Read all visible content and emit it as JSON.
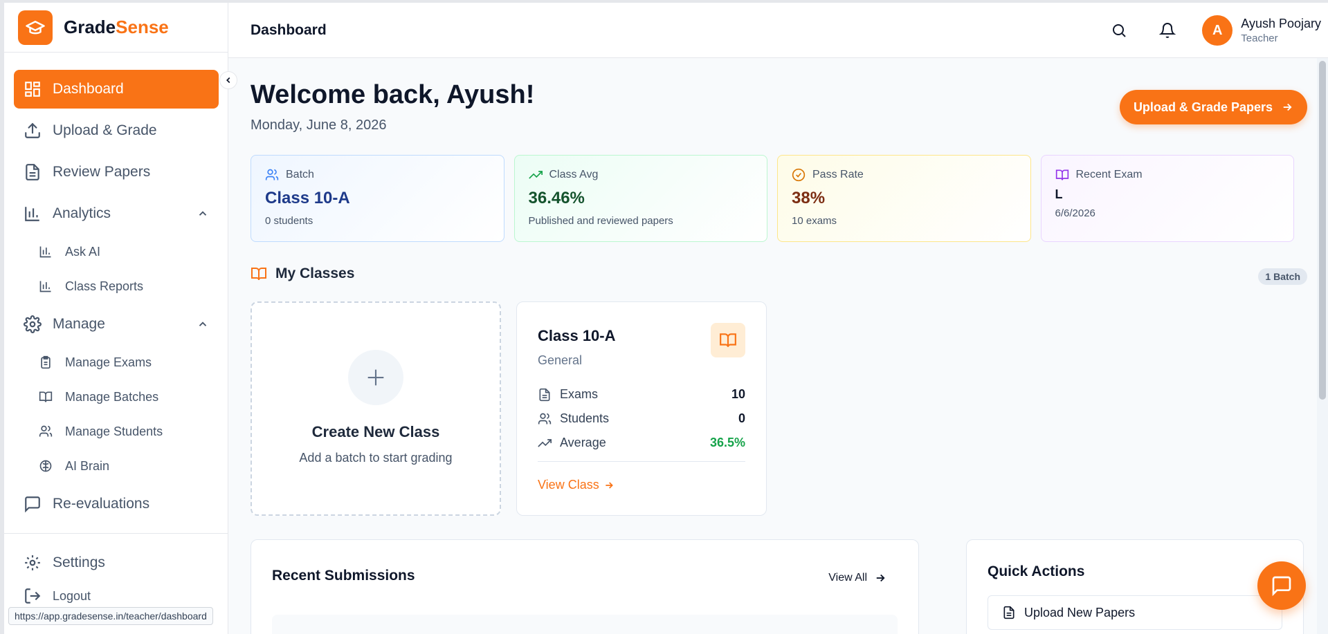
{
  "brand": {
    "name_part1": "Grade",
    "name_part2": "Sense",
    "accent_color": "#f97316"
  },
  "sidebar": {
    "items": [
      {
        "label": "Dashboard",
        "icon": "dashboard-icon",
        "active": true
      },
      {
        "label": "Upload & Grade",
        "icon": "upload-icon"
      },
      {
        "label": "Review Papers",
        "icon": "document-icon"
      },
      {
        "label": "Analytics",
        "icon": "bar-chart-icon",
        "expanded": true
      },
      {
        "label": "Ask AI",
        "icon": "bar-chart-icon"
      },
      {
        "label": "Class Reports",
        "icon": "bar-chart-icon"
      },
      {
        "label": "Manage",
        "icon": "gear-icon",
        "expanded": true
      },
      {
        "label": "Manage Exams",
        "icon": "clipboard-icon"
      },
      {
        "label": "Manage Batches",
        "icon": "book-icon"
      },
      {
        "label": "Manage Students",
        "icon": "users-icon"
      },
      {
        "label": "AI Brain",
        "icon": "brain-icon"
      },
      {
        "label": "Re-evaluations",
        "icon": "message-icon"
      }
    ],
    "settings_label": "Settings",
    "logout_label": "Logout"
  },
  "status_url": "https://app.gradesense.in/teacher/dashboard",
  "header": {
    "title": "Dashboard",
    "user_name": "Ayush Poojary",
    "user_role": "Teacher",
    "avatar_initial": "A"
  },
  "main": {
    "welcome": "Welcome back, Ayush!",
    "date": "Monday, June 8, 2026",
    "primary_action": "Upload & Grade Papers",
    "stats": [
      {
        "label": "Batch",
        "value": "Class 10-A",
        "sub": "0 students",
        "color": "#1e3a8a"
      },
      {
        "label": "Class Avg",
        "value": "36.46%",
        "sub": "Published and reviewed papers",
        "color": "#14532d"
      },
      {
        "label": "Pass Rate",
        "value": "38%",
        "sub": "10 exams",
        "color": "#7c2d12"
      },
      {
        "label": "Recent Exam",
        "value": "L",
        "sub": "6/6/2026",
        "color": "#0f172a"
      }
    ],
    "my_classes": {
      "title": "My Classes",
      "badge": "1 Batch",
      "create": {
        "title": "Create New Class",
        "sub": "Add a batch to start grading"
      },
      "class_card": {
        "name": "Class 10-A",
        "sub": "General",
        "rows": [
          {
            "label": "Exams",
            "value": "10"
          },
          {
            "label": "Students",
            "value": "0"
          },
          {
            "label": "Average",
            "value": "36.5%"
          }
        ],
        "link": "View Class"
      }
    },
    "recent_submissions": {
      "title": "Recent Submissions",
      "view_all": "View All"
    },
    "quick_actions": {
      "title": "Quick Actions",
      "first_action": "Upload New Papers"
    }
  }
}
